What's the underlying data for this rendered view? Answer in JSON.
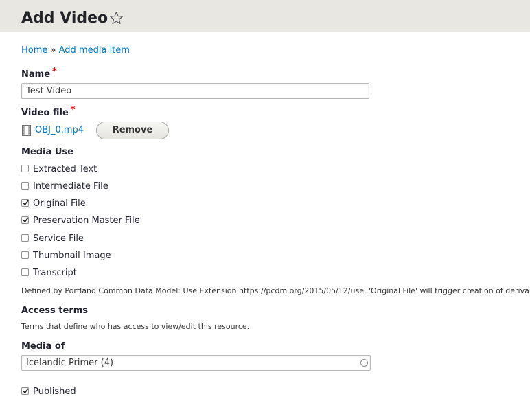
{
  "header": {
    "title": "Add Video",
    "star_icon": "star-outline-icon"
  },
  "breadcrumb": {
    "home": "Home",
    "separator": "»",
    "current": "Add media item"
  },
  "name_field": {
    "label": "Name",
    "required_marker": "*",
    "value": "Test Video"
  },
  "video_file": {
    "label": "Video file",
    "required_marker": "*",
    "file_icon": "file-video-icon",
    "file_name": "OBJ_0.mp4",
    "remove_label": "Remove"
  },
  "media_use": {
    "label": "Media Use",
    "options": [
      {
        "label": "Extracted Text",
        "checked": false
      },
      {
        "label": "Intermediate File",
        "checked": false
      },
      {
        "label": "Original File",
        "checked": true
      },
      {
        "label": "Preservation Master File",
        "checked": true
      },
      {
        "label": "Service File",
        "checked": false
      },
      {
        "label": "Thumbnail Image",
        "checked": false
      },
      {
        "label": "Transcript",
        "checked": false
      }
    ],
    "description": "Defined by Portland Common Data Model: Use Extension https://pcdm.org/2015/05/12/use. 'Original File' will trigger creation of deriva"
  },
  "access_terms": {
    "label": "Access terms",
    "description": "Terms that define who has access to view/edit this resource."
  },
  "media_of": {
    "label": "Media of",
    "value": "Icelandic Primer (4)",
    "autocomplete_icon": "autocomplete-circle-icon"
  },
  "published": {
    "label": "Published",
    "checked": true
  }
}
